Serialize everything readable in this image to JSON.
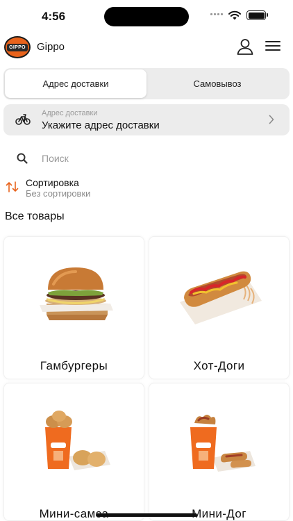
{
  "status": {
    "time": "4:56"
  },
  "header": {
    "logo_text": "GIPPO",
    "brand": "Gippo"
  },
  "delivery_toggle": {
    "options": [
      "Адрес доставки",
      "Самовывоз"
    ],
    "selected": "Адрес доставки"
  },
  "address": {
    "label": "Адрес доставки",
    "value": "Укажите адрес доставки"
  },
  "search": {
    "placeholder": "Поиск"
  },
  "sort": {
    "title": "Сортировка",
    "value": "Без сортировки"
  },
  "section": {
    "title": "Все товары"
  },
  "products": [
    {
      "name": "Гамбургеры",
      "icon": "burger-image"
    },
    {
      "name": "Хот-Доги",
      "icon": "hotdog-image"
    },
    {
      "name": "Мини-самса",
      "icon": "mini-samsa-image"
    },
    {
      "name": "Мини-Дог",
      "icon": "mini-dog-image"
    }
  ],
  "colors": {
    "accent": "#e8631c",
    "panel": "#ececec",
    "muted": "#9a9a9a"
  }
}
